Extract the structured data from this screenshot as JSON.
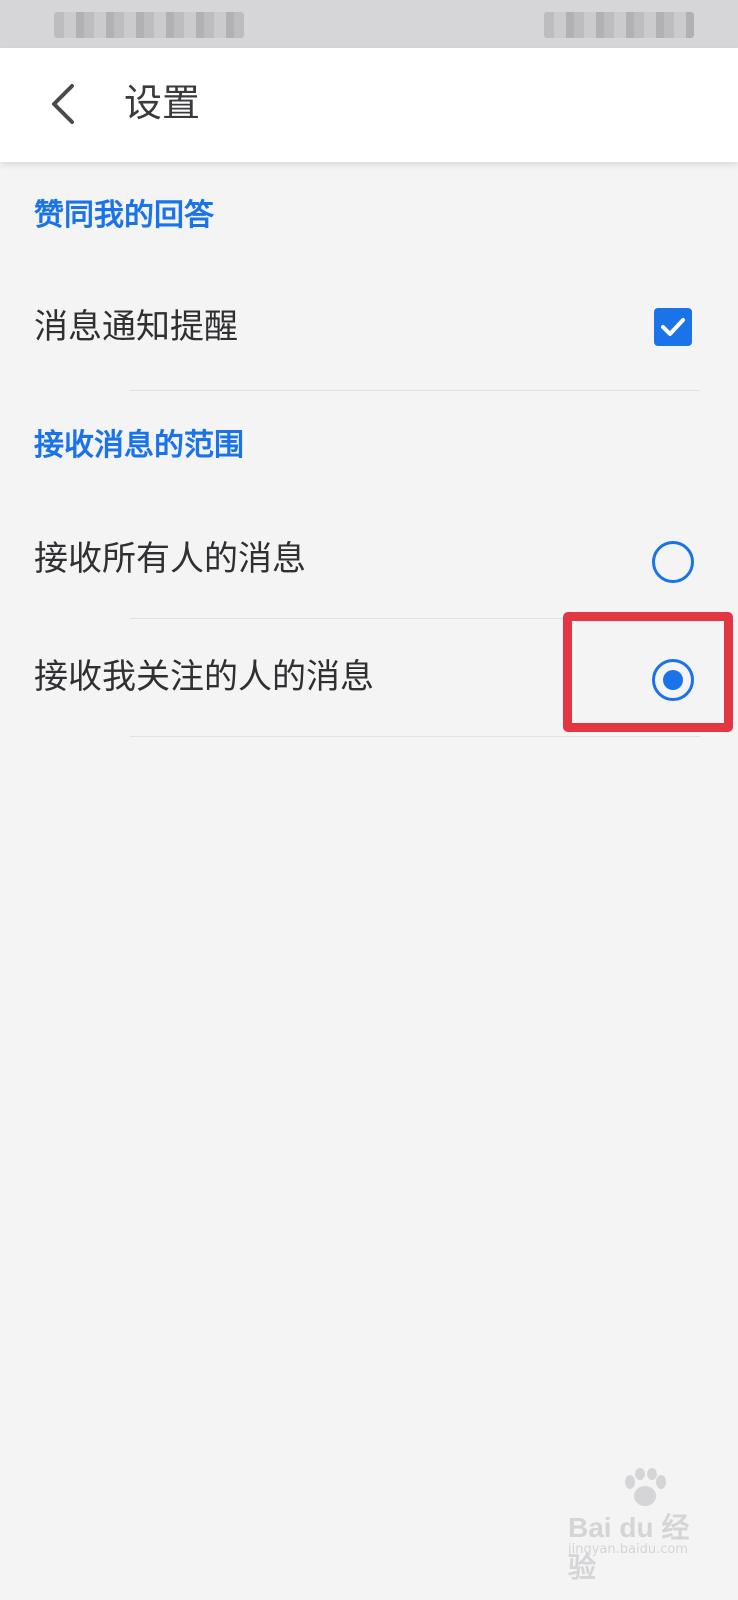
{
  "header": {
    "title": "设置",
    "back_icon": "chevron-left-icon"
  },
  "sections": [
    {
      "title": "赞同我的回答",
      "items": [
        {
          "label": "消息通知提醒",
          "control": "checkbox",
          "checked": true
        }
      ]
    },
    {
      "title": "接收消息的范围",
      "items": [
        {
          "label": "接收所有人的消息",
          "control": "radio",
          "selected": false
        },
        {
          "label": "接收我关注的人的消息",
          "control": "radio",
          "selected": true
        }
      ]
    }
  ],
  "colors": {
    "accent": "#1a73e8",
    "highlight": "#e23742",
    "background": "#f4f4f5",
    "header_bg": "#ffffff",
    "text": "#303033"
  },
  "watermark": {
    "brand": "Bai du 经验",
    "url": "jingyan.baidu.com"
  }
}
